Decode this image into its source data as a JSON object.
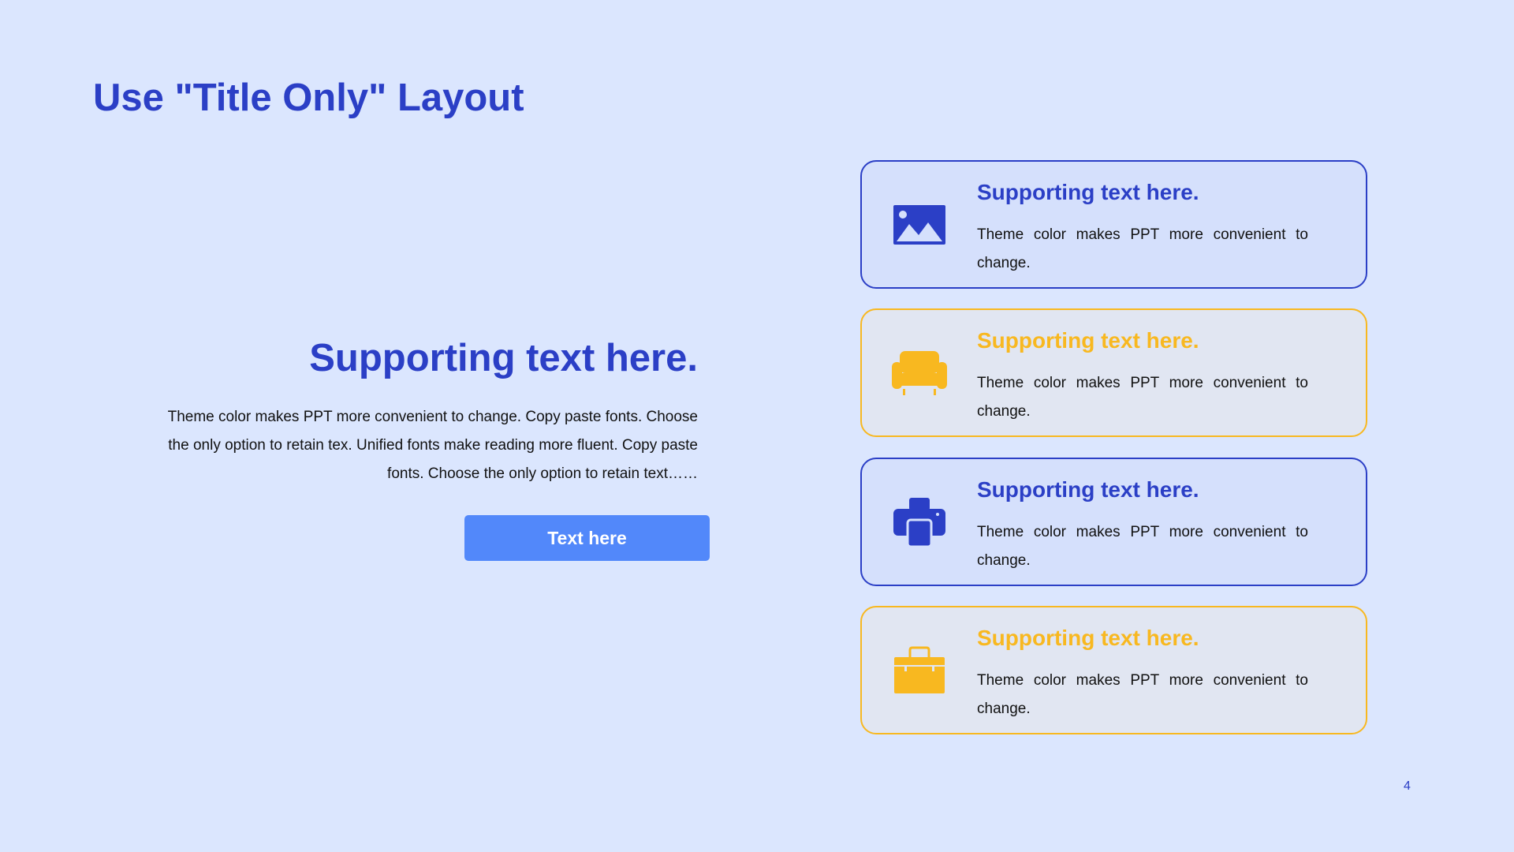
{
  "title": "Use \"Title Only\" Layout",
  "left": {
    "heading": "Supporting text here.",
    "body": "Theme color makes PPT more convenient to change. Copy paste fonts. Choose the only option to retain tex. Unified fonts make reading more fluent. Copy paste fonts. Choose the only option to retain text……",
    "button_label": "Text here"
  },
  "cards": [
    {
      "icon": "image-icon",
      "title": "Supporting text here.",
      "text": "Theme color makes PPT more convenient to change."
    },
    {
      "icon": "sofa-icon",
      "title": "Supporting text here.",
      "text": "Theme color makes PPT more convenient to change."
    },
    {
      "icon": "printer-icon",
      "title": "Supporting text here.",
      "text": "Theme color makes PPT more convenient to change."
    },
    {
      "icon": "toolbox-icon",
      "title": "Supporting text here.",
      "text": "Theme color makes PPT more convenient to change."
    }
  ],
  "page_number": "4",
  "colors": {
    "background": "#dbe6fe",
    "primary_blue": "#2b3fc6",
    "accent_yellow": "#f8b820",
    "button_blue": "#5288fa"
  }
}
